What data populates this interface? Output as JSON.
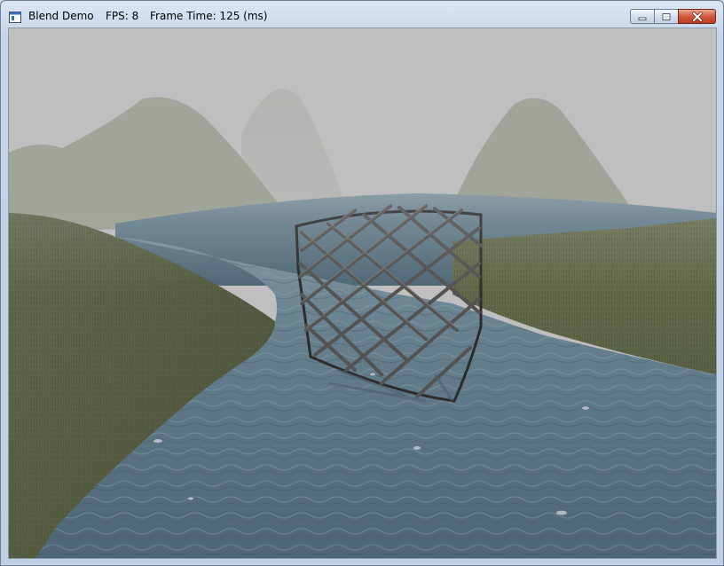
{
  "window": {
    "title": "Blend Demo",
    "fps": "FPS: 8",
    "frame_time": "Frame Time: 125 (ms)"
  },
  "controls": {
    "minimize_icon": "minimize-icon",
    "maximize_icon": "maximize-icon",
    "close_icon": "close-icon"
  },
  "scene": {
    "fog_color": "#bfbfbf",
    "water_color": "#5d7789",
    "grass_color": "#5e6346",
    "hill_color": "#8f9383",
    "crate_color": "#3c3a3a"
  }
}
